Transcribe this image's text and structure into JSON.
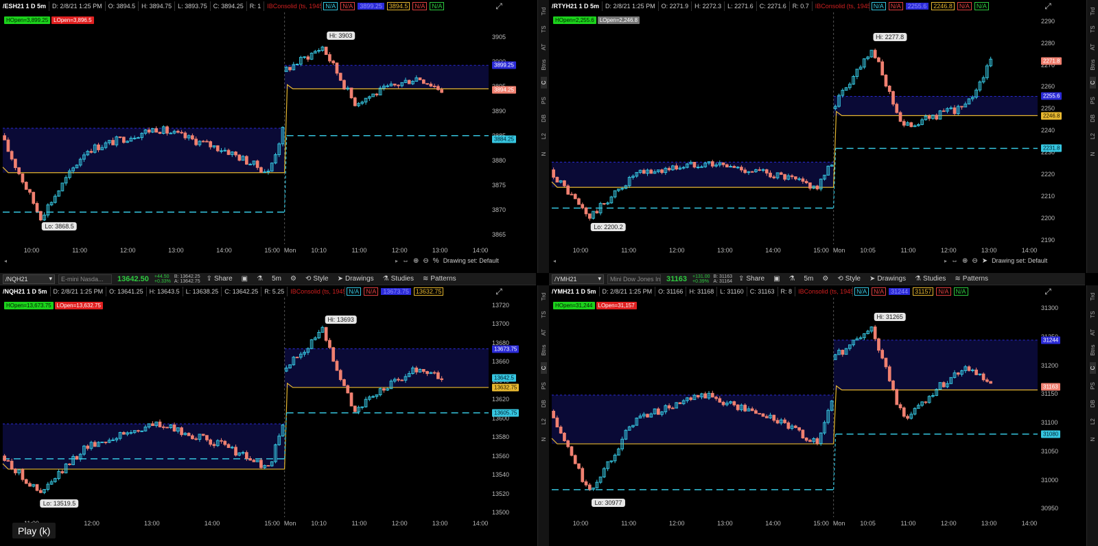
{
  "colors": {
    "up": "#36c6e0",
    "down": "#f08070",
    "gold": "#e8b830",
    "cyan": "#36c6e0",
    "navy": "#0a0a3a",
    "blue_tag": "#2b2bd8"
  },
  "panels": [
    {
      "toolbar": null,
      "info": {
        "symbol": "/ESH21 1 D 5m",
        "date": "D: 2/8/21 1:25 PM",
        "open": "O: 3894.5",
        "high": "H: 3894.75",
        "low": "L: 3893.75",
        "close": "C: 3894.25",
        "range": "R: 1",
        "study": "IBConsolid (ts, 1945, 30, yes, 15, Blue)",
        "na1": "N/A",
        "na2": "N/A",
        "blue": "3899.25",
        "gold": "3894.5",
        "na3": "N/A",
        "na4": "N/A"
      },
      "bubbles": {
        "hopen": "HOpen=3,899.25",
        "lopen": "LOpen=3,896.5",
        "lopen_gray": false
      },
      "hi_label": "Hi: 3903",
      "lo_label": "Lo: 3868.5",
      "yticks": [
        "3905",
        "3900",
        "3895",
        "3890",
        "3885",
        "3880",
        "3875",
        "3870",
        "3865"
      ],
      "tags": [
        {
          "text": "3899.25",
          "value": 3899.25,
          "bg": "#2b2bd8",
          "fg": "#ffffff"
        },
        {
          "text": "3894.25",
          "value": 3894.25,
          "bg": "#f08070",
          "fg": "#ffffff"
        },
        {
          "text": "3884.25",
          "value": 3884.25,
          "bg": "#36c6e0",
          "fg": "#002030"
        }
      ],
      "xticks": [
        "10:00",
        "11:00",
        "12:00",
        "13:00",
        "14:00",
        "15:00",
        "Mon",
        "10:10",
        "11:00",
        "12:00",
        "13:00",
        "14:00"
      ],
      "drawing_set": "Drawing set: Default",
      "series": {
        "ymin": 3863,
        "ymax": 3910,
        "hi": 3903,
        "lo": 3868.5,
        "ib_top": 3899.25,
        "ib_bot": 3894.5,
        "prev_box_top": 3886.5,
        "prev_box_bot": 3877.5,
        "gold_prev": 3877.5,
        "gold_now": 3894.5,
        "cyan_prev": 3869.5,
        "cyan_now": 3885,
        "start": 3885,
        "end": 3894.25,
        "gap_open": 3898
      }
    },
    {
      "toolbar": null,
      "info": {
        "symbol": "/RTYH21 1 D 5m",
        "date": "D: 2/8/21 1:25 PM",
        "open": "O: 2271.9",
        "high": "H: 2272.3",
        "low": "L: 2271.6",
        "close": "C: 2271.6",
        "range": "R: 0.7",
        "study": "IBConsolid (ts, 1945, 30, yes, 15, Blue)",
        "na1": "N/A",
        "na2": "N/A",
        "blue": "2255.6",
        "gold": "2246.8",
        "na3": "N/A",
        "na4": "N/A"
      },
      "bubbles": {
        "hopen": "HOpen=2,255.6",
        "lopen": "LOpen=2,246.8",
        "lopen_gray": true
      },
      "hi_label": "Hi: 2277.8",
      "lo_label": "Lo: 2200.2",
      "yticks": [
        "2290",
        "2280",
        "2270",
        "2260",
        "2250",
        "2240",
        "2230",
        "2220",
        "2210",
        "2200",
        "2190"
      ],
      "tags": [
        {
          "text": "2271.8",
          "value": 2271.8,
          "bg": "#f08070",
          "fg": "#ffffff"
        },
        {
          "text": "2255.6",
          "value": 2255.6,
          "bg": "#2b2bd8",
          "fg": "#ffffff"
        },
        {
          "text": "2246.8",
          "value": 2246.8,
          "bg": "#e8b830",
          "fg": "#201800"
        },
        {
          "text": "2231.8",
          "value": 2231.8,
          "bg": "#36c6e0",
          "fg": "#002030"
        }
      ],
      "xticks": [
        "10:00",
        "11:00",
        "12:00",
        "13:00",
        "14:00",
        "15:00",
        "Mon",
        "10:05",
        "11:00",
        "12:00",
        "13:00",
        "14:00"
      ],
      "drawing_set": "Drawing set: Default",
      "series": {
        "ymin": 2188,
        "ymax": 2294,
        "hi": 2277.8,
        "lo": 2200.2,
        "ib_top": 2255.6,
        "ib_bot": 2246.8,
        "prev_box_top": 2225.5,
        "prev_box_bot": 2214,
        "gold_prev": 2214,
        "gold_now": 2246.8,
        "cyan_prev": 2204.5,
        "cyan_now": 2231.8,
        "start": 2222,
        "end": 2271.6,
        "gap_open": 2250
      }
    },
    {
      "toolbar": {
        "symbol": "/NQH21",
        "desc": "E-mini Nasda...",
        "last": "13642.50",
        "netch1": "+44.50",
        "netch2": "+0.33%",
        "bid": "B: 13642.25",
        "ask": "A: 13642.75",
        "share": "Share",
        "interval": "5m",
        "style": "Style",
        "drawings": "Drawings",
        "studies": "Studies",
        "patterns": "Patterns"
      },
      "info": {
        "symbol": "/NQH21 1 D 5m",
        "date": "D: 2/8/21 1:25 PM",
        "open": "O: 13641.25",
        "high": "H: 13643.5",
        "low": "L: 13638.25",
        "close": "C: 13642.25",
        "range": "R: 5.25",
        "study": "IBConsolid (ts, 1945, 30, yes, 15, Blue)",
        "na1": "N/A",
        "na2": "N/A",
        "blue": "13673.75",
        "gold": "13632.75",
        "na3": "",
        "na4": ""
      },
      "bubbles": {
        "hopen": "HOpen=13,673.75",
        "lopen": "LOpen=13,632.75",
        "lopen_gray": false
      },
      "hi_label": "Hi: 13693",
      "lo_label": "Lo: 13519.5",
      "yticks": [
        "13720",
        "13700",
        "13680",
        "13660",
        "13640",
        "13620",
        "13600",
        "13580",
        "13560",
        "13540",
        "13520",
        "13500"
      ],
      "tags": [
        {
          "text": "13673.75",
          "value": 13673.75,
          "bg": "#2b2bd8",
          "fg": "#ffffff"
        },
        {
          "text": "13642.5",
          "value": 13642.5,
          "bg": "#36c6e0",
          "fg": "#002030"
        },
        {
          "text": "13632.75",
          "value": 13632.75,
          "bg": "#e8b830",
          "fg": "#201800"
        },
        {
          "text": "13605.75",
          "value": 13605.75,
          "bg": "#36c6e0",
          "fg": "#002030"
        }
      ],
      "xticks": [
        "11:00",
        "12:00",
        "13:00",
        "14:00",
        "15:00",
        "Mon",
        "10:10",
        "11:00",
        "12:00",
        "13:00",
        "14:00"
      ],
      "drawing_set": "",
      "series": {
        "ymin": 13495,
        "ymax": 13728,
        "hi": 13693,
        "lo": 13519.5,
        "ib_top": 13673.75,
        "ib_bot": 13632.75,
        "prev_box_top": 13594,
        "prev_box_bot": 13546,
        "gold_prev": 13546,
        "gold_now": 13632.75,
        "cyan_prev": 13557,
        "cyan_now": 13605.75,
        "start": 13560,
        "end": 13642.25,
        "gap_open": 13650
      }
    },
    {
      "toolbar": {
        "symbol": "/YMH21",
        "desc": "Mini Dow Jones In...",
        "last": "31163",
        "netch1": "+131.00",
        "netch2": "+0.39%",
        "bid": "B: 31163",
        "ask": "A: 31164",
        "share": "Share",
        "interval": "5m",
        "style": "Style",
        "drawings": "Drawings",
        "studies": "Studies",
        "patterns": "Patterns"
      },
      "info": {
        "symbol": "/YMH21 1 D 5m",
        "date": "D: 2/8/21 1:25 PM",
        "open": "O: 31166",
        "high": "H: 31168",
        "low": "L: 31160",
        "close": "C: 31163",
        "range": "R: 8",
        "study": "IBConsolid (ts, 1945, 30, yes, 15, Blue)",
        "na1": "N/A",
        "na2": "N/A",
        "blue": "31244",
        "gold": "31157",
        "na3": "N/A",
        "na4": "N/A"
      },
      "bubbles": {
        "hopen": "HOpen=31,244",
        "lopen": "LOpen=31,157",
        "lopen_gray": false
      },
      "hi_label": "Hi: 31265",
      "lo_label": "Lo: 30977",
      "yticks": [
        "31300",
        "31250",
        "31200",
        "31150",
        "31100",
        "31050",
        "31000",
        "30950"
      ],
      "tags": [
        {
          "text": "31244",
          "value": 31244,
          "bg": "#2b2bd8",
          "fg": "#ffffff"
        },
        {
          "text": "31163",
          "value": 31163,
          "bg": "#f08070",
          "fg": "#ffffff"
        },
        {
          "text": "31080",
          "value": 31080,
          "bg": "#36c6e0",
          "fg": "#002030"
        }
      ],
      "xticks": [
        "10:00",
        "11:00",
        "12:00",
        "13:00",
        "14:00",
        "15:00",
        "Mon",
        "10:05",
        "11:00",
        "12:00",
        "13:00",
        "14:00"
      ],
      "drawing_set": "",
      "series": {
        "ymin": 30935,
        "ymax": 31318,
        "hi": 31265,
        "lo": 30977,
        "ib_top": 31244,
        "ib_bot": 31157,
        "prev_box_top": 31148,
        "prev_box_bot": 31063,
        "gold_prev": 31063,
        "gold_now": 31157,
        "cyan_prev": 30983,
        "cyan_now": 31080,
        "start": 31120,
        "end": 31163,
        "gap_open": 31210
      }
    }
  ],
  "sidetabs": [
    "Trd",
    "TS",
    "AT",
    "Btns",
    "C",
    "PS",
    "DB",
    "L2",
    "N"
  ],
  "play_button": "Play (k)"
}
